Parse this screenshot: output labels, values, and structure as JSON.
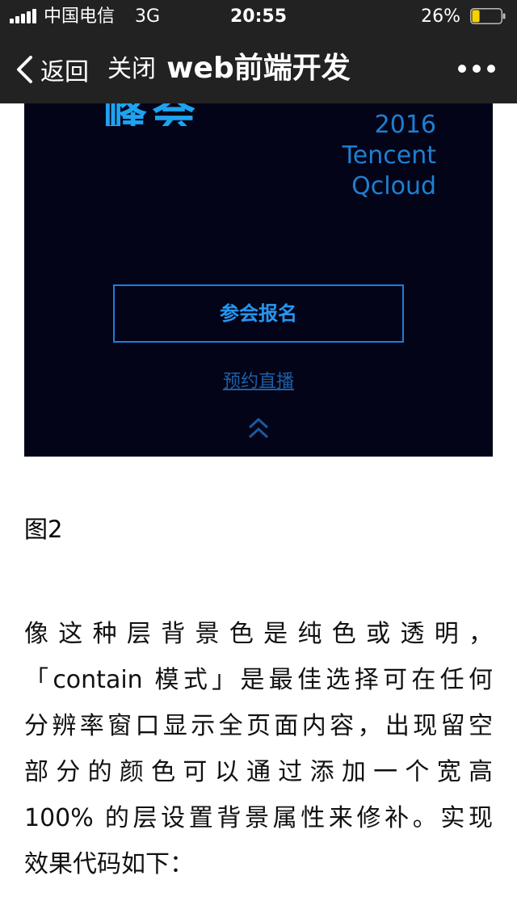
{
  "status_bar": {
    "carrier": "中国电信",
    "network": "3G",
    "time": "20:55",
    "battery_percent": "26%",
    "battery_level": 0.26,
    "signal_icon": "signal-bars-icon",
    "battery_icon": "battery-icon"
  },
  "nav": {
    "back_label": "返回",
    "close_label": "关闭",
    "title": "web前端开发",
    "back_icon": "chevron-left-icon",
    "more_icon": "more-dots-icon"
  },
  "banner": {
    "logo_text": "峰会",
    "year": "2016",
    "brand_line1": "Tencent",
    "brand_line2": "Qcloud",
    "register_label": "参会报名",
    "live_label": "预约直播",
    "up_icon": "double-chevron-up-icon",
    "accent_color": "#1e90ff",
    "background_color": "#030418"
  },
  "caption": "图2",
  "article": {
    "lines": [
      "像这种层背景色是纯色或透明，",
      "「contain 模式」是最佳选择可在任何",
      "分辨率窗口显示全页面内容，出现留空",
      "部分的颜色可以通过添加一个宽高",
      "100% 的层设置背景属性来修补。实现",
      "效果代码如下："
    ]
  }
}
